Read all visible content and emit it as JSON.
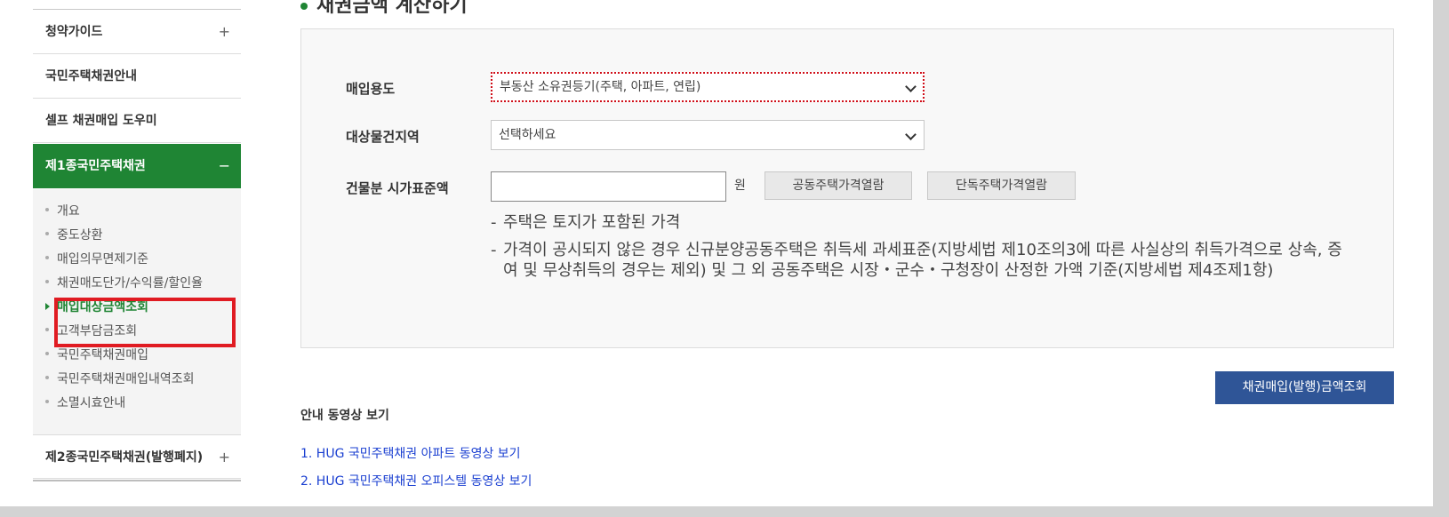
{
  "sidebar": {
    "items": [
      {
        "label": "청약가이드",
        "toggle": "+"
      },
      {
        "label": "국민주택채권안내",
        "toggle": ""
      },
      {
        "label": "셀프 채권매입 도우미",
        "toggle": ""
      },
      {
        "label": "제1종국민주택채권",
        "toggle": "−"
      },
      {
        "label": "제2종국민주택채권(발행폐지)",
        "toggle": "+"
      }
    ],
    "submenu": [
      {
        "label": "개요"
      },
      {
        "label": "중도상환"
      },
      {
        "label": "매입의무면제기준"
      },
      {
        "label": "채권매도단가/수익률/할인율"
      },
      {
        "label": "매입대상금액조회"
      },
      {
        "label": "고객부담금조회"
      },
      {
        "label": "국민주택채권매입"
      },
      {
        "label": "국민주택채권매입내역조회"
      },
      {
        "label": "소멸시효안내"
      }
    ]
  },
  "main": {
    "heading": "채권금액 계산하기",
    "form": {
      "purpose_label": "매입용도",
      "purpose_value": "부동산 소유권등기(주택, 아파트, 연립)",
      "region_label": "대상물건지역",
      "region_value": "선택하세요",
      "price_label": "건물분 시가표준액",
      "price_value": "",
      "price_unit": "원",
      "apt_price_button": "공동주택가격열람",
      "house_price_button": "단독주택가격열람",
      "notes": [
        "주택은 토지가 포함된 가격",
        "가격이 공시되지 않은 경우 신규분양공동주택은 취득세 과세표준(지방세법 제10조의3에 따른 사실상의 취득가격으로 상속, 증여 및 무상취득의 경우는 제외) 및 그 외 공동주택은 시장・군수・구청장이 산정한 가액 기준(지방세법 제4조제1항)"
      ],
      "note_dash": "-"
    },
    "lookup_button": "채권매입(발행)금액조회",
    "video_section_title": "안내 동영상 보기",
    "video_links": [
      "1. HUG 국민주택채권 아파트 동영상 보기",
      "2. HUG 국민주택채권 오피스텔 동영상 보기"
    ]
  },
  "colors": {
    "accent_green": "#1f8534",
    "primary_blue": "#2f5597",
    "highlight_red": "#e01b22",
    "link_blue": "#1a3fd1"
  }
}
